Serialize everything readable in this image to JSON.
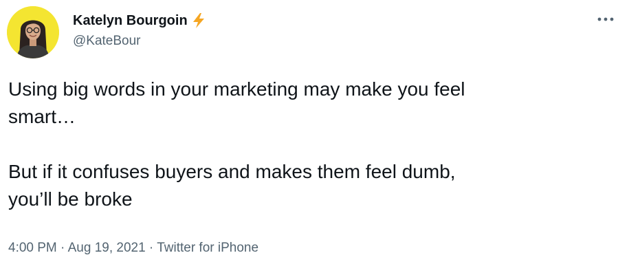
{
  "author": {
    "name": "Katelyn Bourgoin",
    "handle": "@KateBour",
    "badge_icon": "lightning-bolt-icon",
    "avatar_bg": "#f4e531"
  },
  "tweet": {
    "line1": "Using big words in your marketing may make you feel",
    "line2": "smart…",
    "line3": "But if it confuses buyers and makes them feel dumb,",
    "line4": "you’ll be broke"
  },
  "meta": {
    "time": "4:00 PM",
    "separator1": " · ",
    "date": "Aug 19, 2021",
    "separator2": " · ",
    "source": "Twitter for iPhone"
  },
  "more_icon": "more-dots-icon",
  "colors": {
    "text": "#0f1419",
    "secondary": "#536471",
    "bolt": "#f5a623"
  }
}
